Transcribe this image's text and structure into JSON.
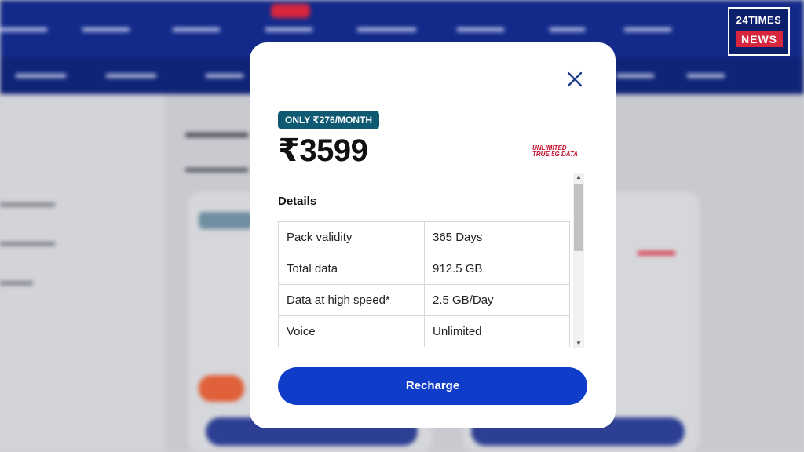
{
  "logo": {
    "line1": "24TIMES",
    "line2": "NEWS"
  },
  "modal": {
    "tag": "ONLY ₹276/MONTH",
    "price": "₹3599",
    "badge_line1": "UNLIMITED",
    "badge_line2": "TRUE 5G DATA",
    "details_title": "Details",
    "details": [
      {
        "label": "Pack validity",
        "value": "365 Days"
      },
      {
        "label": "Total data",
        "value": "912.5 GB"
      },
      {
        "label": "Data at high speed*",
        "value": "2.5 GB/Day"
      },
      {
        "label": "Voice",
        "value": "Unlimited"
      }
    ],
    "recharge_label": "Recharge"
  },
  "icons": {
    "close": "close-icon",
    "scroll_up": "scroll-up-arrow-icon",
    "scroll_down": "scroll-down-arrow-icon"
  },
  "colors": {
    "primary": "#0f3cc9",
    "tag": "#0f5a73",
    "accent_red": "#c8102e",
    "nav": "#132a8a"
  }
}
